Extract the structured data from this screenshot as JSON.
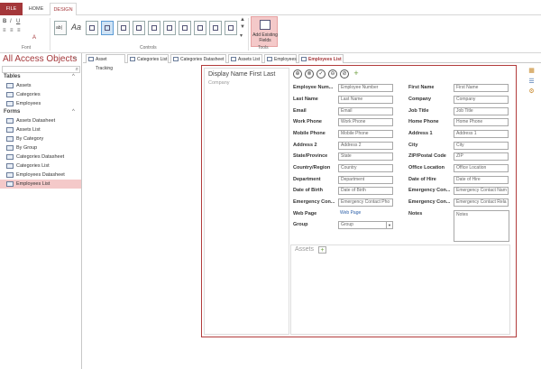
{
  "ribbon": {
    "tabs": [
      "FILE",
      "HOME",
      "DESIGN"
    ],
    "groups": {
      "font": "Font",
      "controls": "Controls",
      "tools": "Tools"
    },
    "add_existing_fields": "Add Existing Fields",
    "label_glyph": "ab|",
    "aa_glyph": "Aa",
    "font_size_glyph": "A",
    "bold_glyph": "B",
    "italic_glyph": "I",
    "underline_glyph": "U"
  },
  "nav": {
    "title": "All Access Objects",
    "close_glyph": "«",
    "search_glyph": "⌕",
    "sections": [
      {
        "label": "Tables",
        "chevron": "^",
        "items": [
          "Assets",
          "Categories",
          "Employees"
        ]
      },
      {
        "label": "Forms",
        "chevron": "^",
        "items": [
          "Assets Datasheet",
          "Assets List",
          "By Category",
          "By Group",
          "Categories Datasheet",
          "Categories List",
          "Employees Datasheet",
          "Employees List"
        ]
      }
    ]
  },
  "doc_tabs": [
    "Asset Tracking",
    "Categories List",
    "Categories Datasheet",
    "Assets List",
    "Employees",
    "Employees List"
  ],
  "form": {
    "display_name": "Display Name First Last",
    "company": "Company",
    "action_glyphs": [
      "⊕",
      "⊗",
      "✓",
      "⊖",
      "⊘",
      "+"
    ],
    "fields_left": [
      {
        "label": "Employee Num...",
        "value": "Employee Number"
      },
      {
        "label": "Last Name",
        "value": "Last Name"
      },
      {
        "label": "Email",
        "value": "Email"
      },
      {
        "label": "Work Phone",
        "value": "Work Phone"
      },
      {
        "label": "Mobile Phone",
        "value": "Mobile Phone"
      },
      {
        "label": "Address 2",
        "value": "Address 2"
      },
      {
        "label": "State/Province",
        "value": "State"
      },
      {
        "label": "Country/Region",
        "value": "Country"
      },
      {
        "label": "Department",
        "value": "Department"
      },
      {
        "label": "Date of Birth",
        "value": "Date of Birth"
      },
      {
        "label": "Emergency Con...",
        "value": "Emergency Contact Pho"
      },
      {
        "label": "Web Page",
        "value": "Web Page"
      },
      {
        "label": "Group",
        "value": "Group"
      }
    ],
    "fields_right": [
      {
        "label": "First Name",
        "value": "First Name"
      },
      {
        "label": "Company",
        "value": "Company"
      },
      {
        "label": "Job Title",
        "value": "Job Title"
      },
      {
        "label": "Home Phone",
        "value": "Home Phone"
      },
      {
        "label": "Address 1",
        "value": "Address 1"
      },
      {
        "label": "City",
        "value": "City"
      },
      {
        "label": "ZIP/Postal Code",
        "value": "ZIP"
      },
      {
        "label": "Office Location",
        "value": "Office Location"
      },
      {
        "label": "Date of Hire",
        "value": "Date of Hire"
      },
      {
        "label": "Emergency Con...",
        "value": "Emergency Contact Nam"
      },
      {
        "label": "Emergency Con...",
        "value": "Emergency Contact Rela"
      },
      {
        "label": "Notes",
        "value": "Notes"
      }
    ],
    "combo_arrow": "▼",
    "assets_label": "Assets",
    "assets_add": "+"
  }
}
